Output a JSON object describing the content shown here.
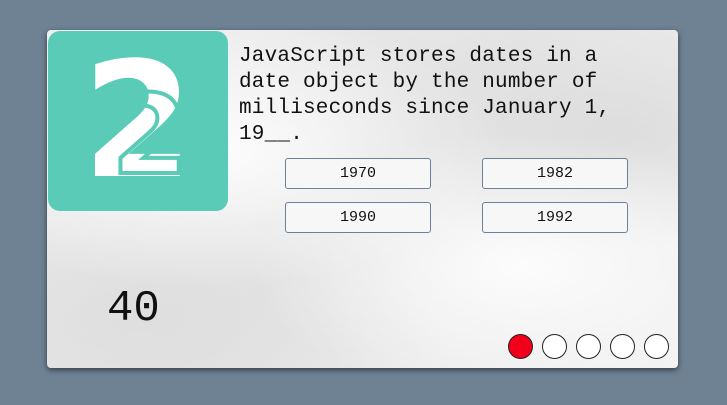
{
  "quiz": {
    "question_number": "2",
    "question": "JavaScript stores dates in a date object by the number of milliseconds since January 1, 19__.",
    "answers": [
      {
        "label": "1970"
      },
      {
        "label": "1982"
      },
      {
        "label": "1990"
      },
      {
        "label": "1992"
      }
    ],
    "timer": "40",
    "progress": {
      "current": 1,
      "total": 5
    }
  },
  "colors": {
    "background": "#6e8294",
    "tile": "#59cbb7",
    "active_dot": "#f2001a",
    "button_border": "#6d7f9a"
  }
}
